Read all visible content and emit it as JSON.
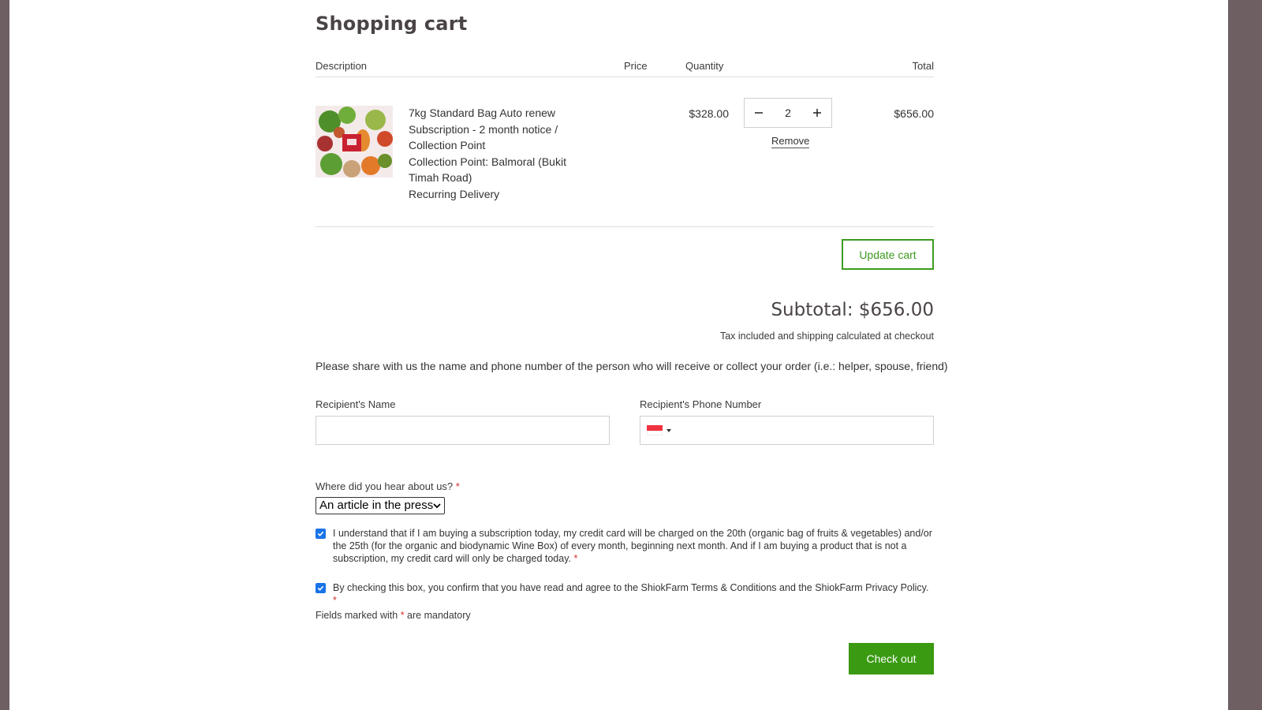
{
  "page": {
    "title": "Shopping cart"
  },
  "table_headers": {
    "description": "Description",
    "price": "Price",
    "quantity": "Quantity",
    "total": "Total"
  },
  "cart_item": {
    "image_icon": "vegetable-bag-image",
    "description_lines": [
      "7kg Standard Bag Auto renew",
      "Subscription - 2 month notice /",
      "Collection Point",
      "Collection Point: Balmoral (Bukit",
      "Timah Road)",
      "Recurring Delivery"
    ],
    "price": "$328.00",
    "quantity": "2",
    "remove_label": "Remove",
    "line_total": "$656.00"
  },
  "actions": {
    "update_cart": "Update cart",
    "checkout": "Check out"
  },
  "summary": {
    "subtotal": "Subtotal: $656.00",
    "tax_note": "Tax included and shipping calculated at checkout"
  },
  "recipient": {
    "intro": "Please share with us the name and phone number of the person who will receive or collect your order (i.e.: helper, spouse, friend)",
    "name_label": "Recipient's Name",
    "name_value": "",
    "phone_label": "Recipient's Phone Number",
    "phone_value": "",
    "phone_country_icon": "singapore-flag-icon"
  },
  "referral": {
    "label": "Where did you hear about us?",
    "selected": "An article in the press"
  },
  "agreements": {
    "billing_text": "I understand that if I am buying a subscription today, my credit card will be charged on the 20th (organic bag of fruits & vegetables) and/or the 25th (for the organic and biodynamic Wine Box) of every month, beginning next month. And if I am buying a product that is not a subscription, my credit card will only be charged today.",
    "billing_checked": true,
    "terms_text": "By checking this box, you confirm that you have read and agree to the ShiokFarm Terms & Conditions and the ShiokFarm Privacy Policy.",
    "terms_checked": true,
    "required_mark": "*"
  },
  "footer_note": {
    "prefix": "Fields marked with",
    "star": "*",
    "suffix": "are mandatory"
  },
  "colors": {
    "brand_green": "#3a9a12",
    "required_red": "#d4302c",
    "checkbox_blue": "#1a73e8",
    "frame": "#6e5f63"
  }
}
